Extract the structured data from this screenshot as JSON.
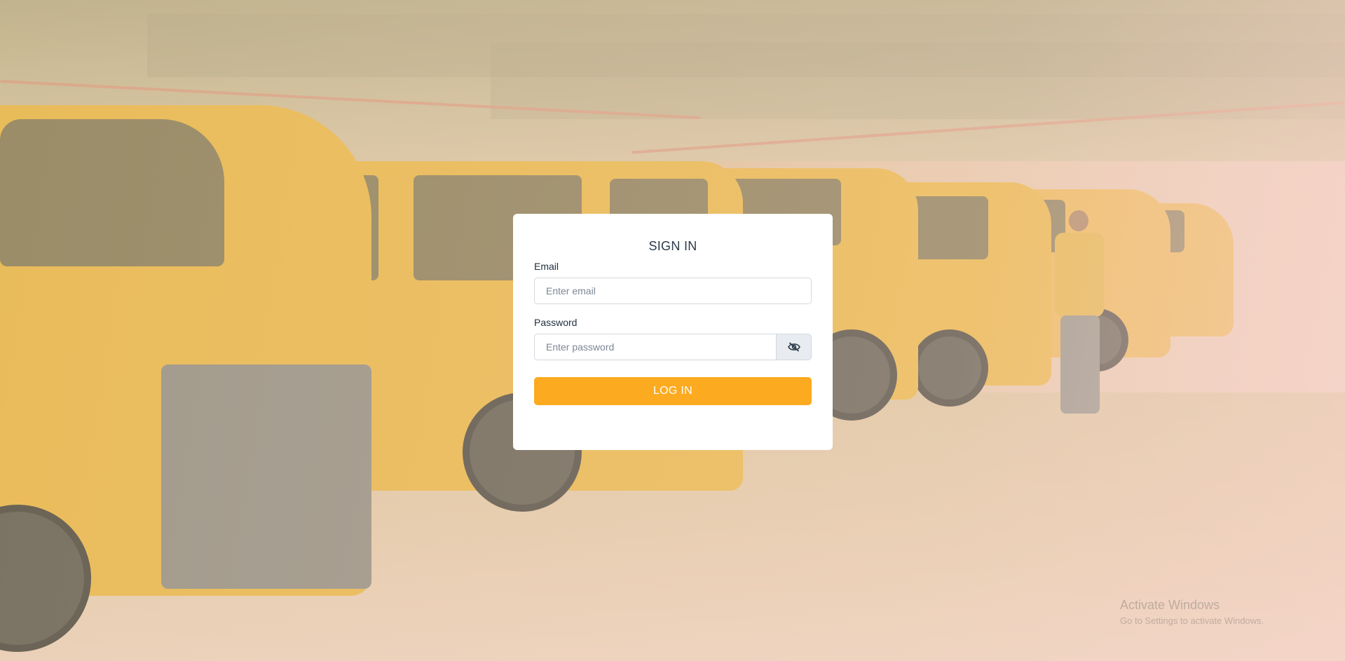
{
  "signin": {
    "title": "SIGN IN",
    "email_label": "Email",
    "email_placeholder": "Enter email",
    "password_label": "Password",
    "password_placeholder": "Enter password",
    "toggle_icon": "eye-slash-icon",
    "login_label": "LOG IN"
  },
  "watermark": {
    "title": "Activate Windows",
    "subtitle": "Go to Settings to activate Windows."
  },
  "colors": {
    "accent": "#fcaa1f",
    "card_bg": "#ffffff",
    "title_text": "#2b3a4a"
  }
}
